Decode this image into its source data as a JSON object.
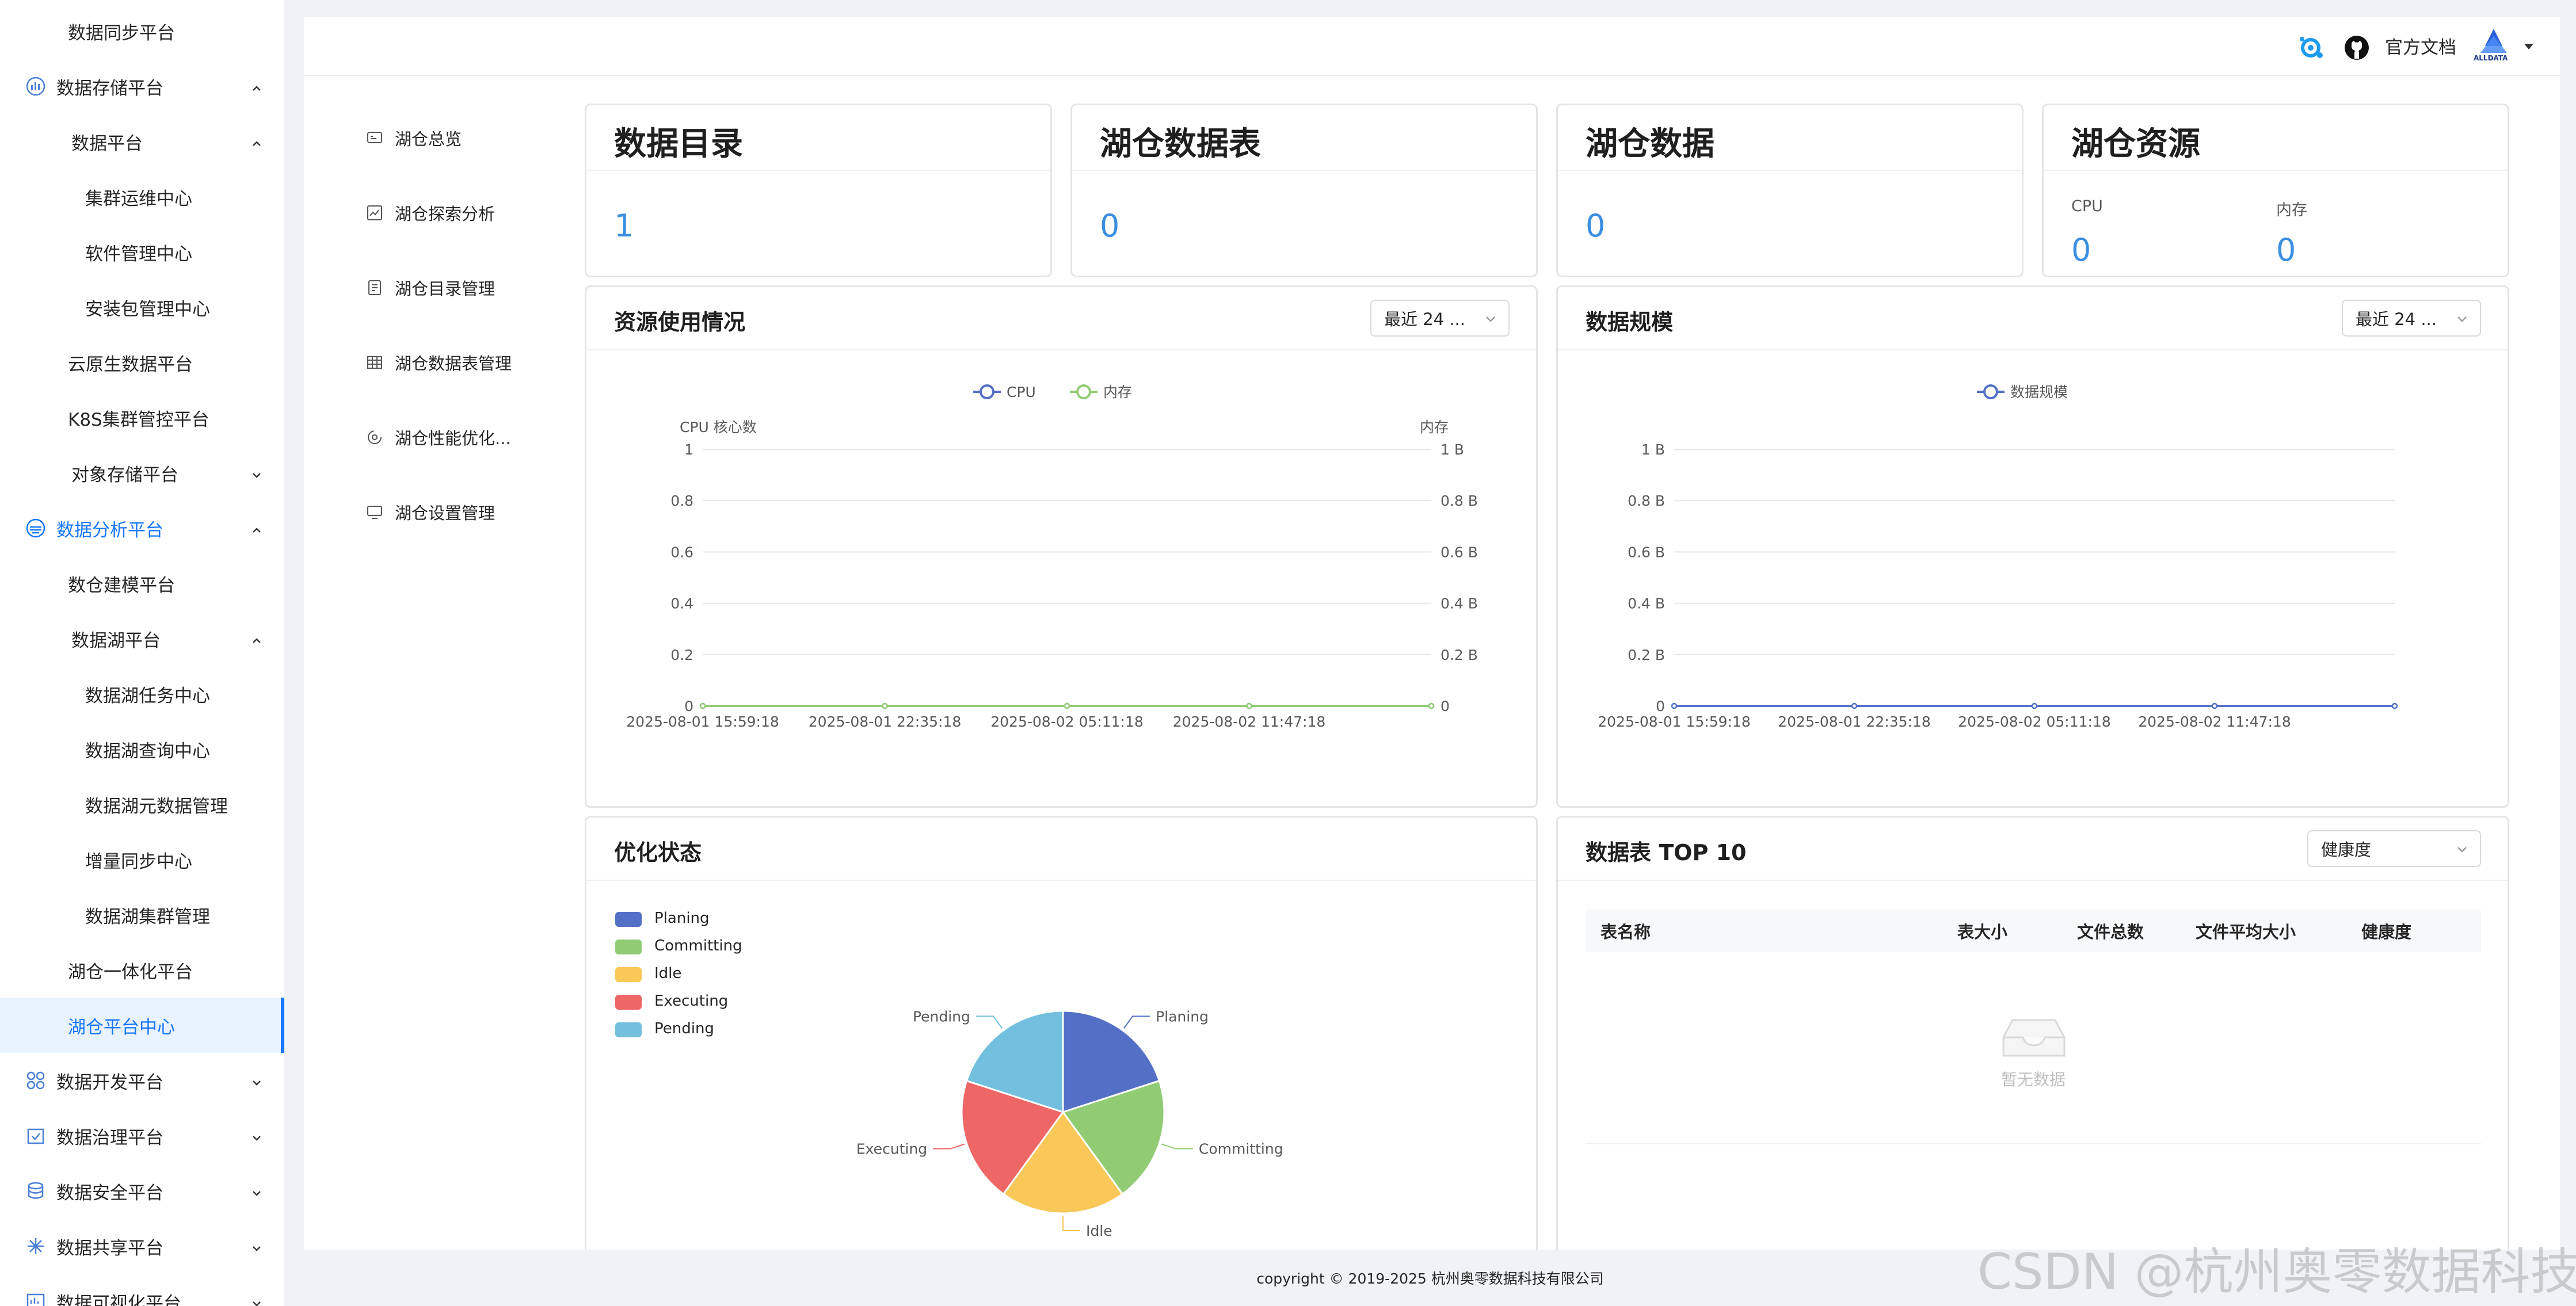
{
  "sidebar": {
    "items": [
      {
        "label": "数据同步平台",
        "level": 1,
        "icon": null,
        "chevron": null
      },
      {
        "label": "数据存储平台",
        "level": 0,
        "icon": "chart-box-icon",
        "chevron": "up"
      },
      {
        "label": "数据平台",
        "level": 1,
        "icon": null,
        "chevron": "up"
      },
      {
        "label": "集群运维中心",
        "level": 2,
        "icon": null,
        "chevron": null
      },
      {
        "label": "软件管理中心",
        "level": 2,
        "icon": null,
        "chevron": null
      },
      {
        "label": "安装包管理中心",
        "level": 2,
        "icon": null,
        "chevron": null
      },
      {
        "label": "云原生数据平台",
        "level": 1,
        "icon": null,
        "chevron": null
      },
      {
        "label": "K8S集群管控平台",
        "level": 1,
        "icon": null,
        "chevron": null
      },
      {
        "label": "对象存储平台",
        "level": 1,
        "icon": null,
        "chevron": "down"
      },
      {
        "label": "数据分析平台",
        "level": 0,
        "icon": "analysis-icon",
        "chevron": "up",
        "highlight": true
      },
      {
        "label": "数仓建模平台",
        "level": 1,
        "icon": null,
        "chevron": null
      },
      {
        "label": "数据湖平台",
        "level": 1,
        "icon": null,
        "chevron": "up"
      },
      {
        "label": "数据湖任务中心",
        "level": 2,
        "icon": null,
        "chevron": null
      },
      {
        "label": "数据湖查询中心",
        "level": 2,
        "icon": null,
        "chevron": null
      },
      {
        "label": "数据湖元数据管理",
        "level": 2,
        "icon": null,
        "chevron": null
      },
      {
        "label": "增量同步中心",
        "level": 2,
        "icon": null,
        "chevron": null
      },
      {
        "label": "数据湖集群管理",
        "level": 2,
        "icon": null,
        "chevron": null
      },
      {
        "label": "湖仓一体化平台",
        "level": 1,
        "icon": null,
        "chevron": null
      },
      {
        "label": "湖仓平台中心",
        "level": 1,
        "icon": null,
        "chevron": null,
        "active": true
      },
      {
        "label": "数据开发平台",
        "level": 0,
        "icon": "grid-icon",
        "chevron": "down"
      },
      {
        "label": "数据治理平台",
        "level": 0,
        "icon": "calendar-check-icon",
        "chevron": "down"
      },
      {
        "label": "数据安全平台",
        "level": 0,
        "icon": "database-icon",
        "chevron": "down"
      },
      {
        "label": "数据共享平台",
        "level": 0,
        "icon": "share-icon",
        "chevron": "down"
      },
      {
        "label": "数据可视化平台",
        "level": 0,
        "icon": "visual-icon",
        "chevron": "down"
      }
    ]
  },
  "topbar": {
    "docs_label": "官方文档",
    "logo_text": "ALLDATA"
  },
  "subnav": {
    "items": [
      {
        "label": "湖仓总览",
        "icon": "overview-icon"
      },
      {
        "label": "湖仓探索分析",
        "icon": "explore-icon"
      },
      {
        "label": "湖仓目录管理",
        "icon": "catalog-icon"
      },
      {
        "label": "湖仓数据表管理",
        "icon": "table-icon"
      },
      {
        "label": "湖仓性能优化...",
        "icon": "optimize-icon"
      },
      {
        "label": "湖仓设置管理",
        "icon": "monitor-icon"
      }
    ]
  },
  "stats": [
    {
      "title": "数据目录",
      "value": "1"
    },
    {
      "title": "湖仓数据表",
      "value": "0"
    },
    {
      "title": "湖仓数据",
      "value": "0"
    },
    {
      "title": "湖仓资源",
      "cpu_label": "CPU",
      "cpu_value": "0",
      "mem_label": "内存",
      "mem_value": "0"
    }
  ],
  "resource_panel": {
    "title": "资源使用情况",
    "select_value": "最近 24 ..."
  },
  "scale_panel": {
    "title": "数据规模",
    "select_value": "最近 24 ..."
  },
  "opt_panel": {
    "title": "优化状态"
  },
  "top_panel": {
    "title": "数据表 TOP 10",
    "select_value": "健康度",
    "columns": [
      "表名称",
      "表大小",
      "文件总数",
      "文件平均大小",
      "健康度"
    ],
    "empty_text": "暂无数据"
  },
  "footer": {
    "text": "copyright © 2019-2025 杭州奥零数据科技有限公司"
  },
  "watermark": "CSDN @杭州奥零数据科技",
  "colors": {
    "accent": "#1677ff",
    "stat_value": "#3a8fe0"
  },
  "chart_data": [
    {
      "type": "line",
      "legend": [
        "CPU",
        "内存"
      ],
      "ylabel_left": "CPU 核心数",
      "ylabel_right": "内存",
      "yticks_left": [
        "0",
        "0.2",
        "0.4",
        "0.6",
        "0.8",
        "1"
      ],
      "yticks_right": [
        "0",
        "0.2 B",
        "0.4 B",
        "0.6 B",
        "0.8 B",
        "1 B"
      ],
      "ylim": [
        0,
        1
      ],
      "x": [
        "2025-08-01  15:59:18",
        "2025-08-01  22:35:18",
        "2025-08-02  05:11:18",
        "2025-08-02  11:47:18"
      ],
      "series": [
        {
          "name": "CPU",
          "values": [
            0,
            0,
            0,
            0,
            0
          ],
          "color": "#5470c6"
        },
        {
          "name": "内存",
          "values": [
            0,
            0,
            0,
            0,
            0
          ],
          "color": "#91cc75"
        }
      ],
      "legend_position": "top-center"
    },
    {
      "type": "line",
      "legend": [
        "数据规模"
      ],
      "yticks": [
        "0",
        "0.2 B",
        "0.4 B",
        "0.6 B",
        "0.8 B",
        "1 B"
      ],
      "ylim": [
        0,
        1
      ],
      "x": [
        "2025-08-01  15:59:18",
        "2025-08-01  22:35:18",
        "2025-08-02  05:11:18",
        "2025-08-02  11:47:18"
      ],
      "series": [
        {
          "name": "数据规模",
          "values": [
            0,
            0,
            0,
            0,
            0
          ],
          "color": "#5470c6"
        }
      ],
      "legend_position": "top-center"
    },
    {
      "type": "pie",
      "legend_position": "top-left",
      "slices": [
        {
          "name": "Planing",
          "value": 1,
          "color": "#5470c6"
        },
        {
          "name": "Committing",
          "value": 1,
          "color": "#91cc75"
        },
        {
          "name": "Idle",
          "value": 1,
          "color": "#fac858"
        },
        {
          "name": "Executing",
          "value": 1,
          "color": "#ee6666"
        },
        {
          "name": "Pending",
          "value": 1,
          "color": "#73c0de"
        }
      ]
    }
  ]
}
